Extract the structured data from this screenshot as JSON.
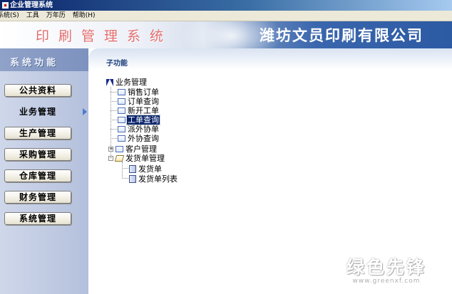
{
  "window": {
    "title": "企业管理系统"
  },
  "menu": [
    "系统(S)",
    "工具",
    "万年历",
    "帮助(H)"
  ],
  "banner": {
    "title": "印刷管理系统",
    "company": "潍坊文员印刷有限公司"
  },
  "sidebar": {
    "header": "系统功能",
    "items": [
      {
        "label": "公共资料",
        "active": false
      },
      {
        "label": "业务管理",
        "active": true
      },
      {
        "label": "生产管理",
        "active": false
      },
      {
        "label": "采购管理",
        "active": false
      },
      {
        "label": "仓库管理",
        "active": false
      },
      {
        "label": "财务管理",
        "active": false
      },
      {
        "label": "系统管理",
        "active": false
      }
    ]
  },
  "panel": {
    "header": "子功能",
    "tree": {
      "root": "业务管理",
      "nodes": [
        {
          "label": "销售订单",
          "icon": "folder-icon"
        },
        {
          "label": "订单查询",
          "icon": "folder-icon"
        },
        {
          "label": "新开工单",
          "icon": "folder-icon"
        },
        {
          "label": "工单查询",
          "icon": "folder-icon",
          "selected": true
        },
        {
          "label": "派外协单",
          "icon": "folder-icon"
        },
        {
          "label": "外协查询",
          "icon": "folder-icon"
        },
        {
          "label": "客户管理",
          "icon": "folder-icon",
          "expander": "+"
        },
        {
          "label": "发货单管理",
          "icon": "folder-open-icon",
          "expander": "-",
          "children": [
            {
              "label": "发货单",
              "icon": "document-icon"
            },
            {
              "label": "发货单列表",
              "icon": "document-icon"
            }
          ]
        }
      ]
    }
  },
  "watermark": {
    "logo": "绿色先锋",
    "url": "www.greenxf.com"
  }
}
